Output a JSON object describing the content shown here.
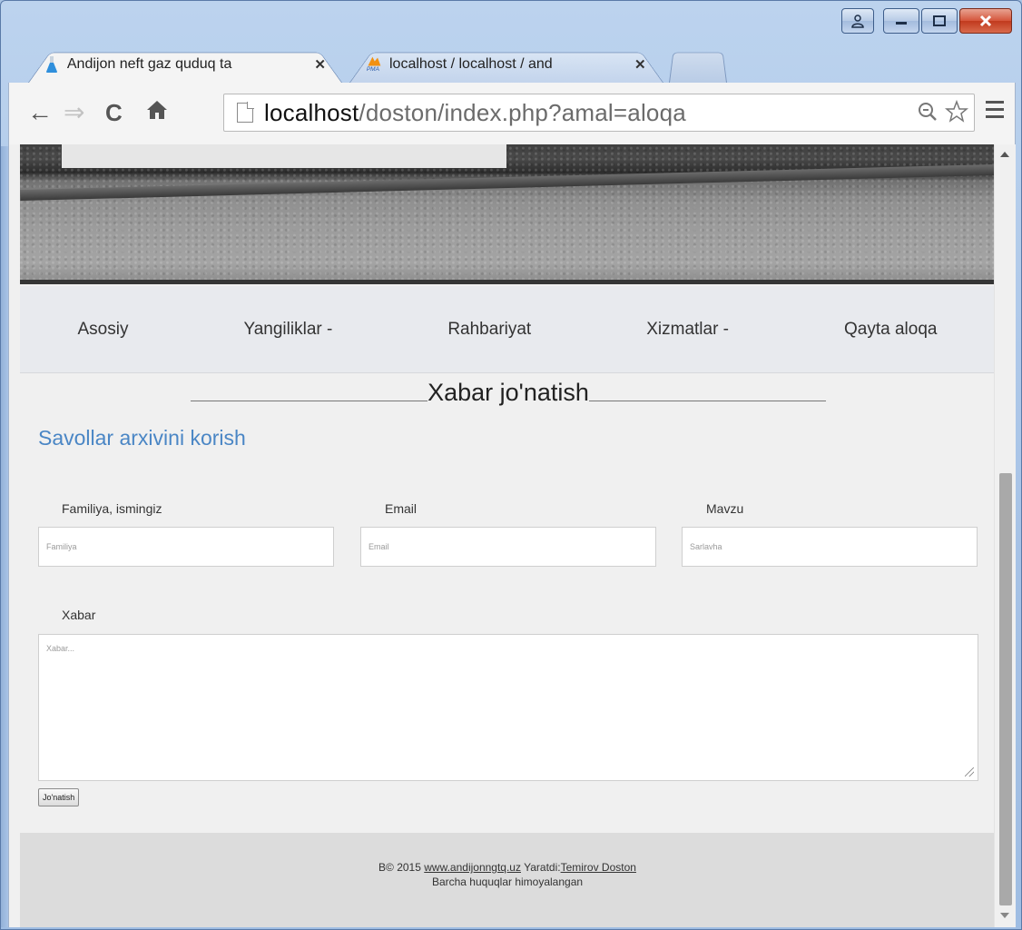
{
  "browser": {
    "tabs": [
      {
        "title": "Andijon neft gaz quduq ta",
        "icon": "flask-icon",
        "active": true
      },
      {
        "title": "localhost / localhost / and",
        "icon": "pma-icon",
        "active": false
      }
    ],
    "new_tab_icon": "new-tab-icon",
    "url_host": "localhost",
    "url_path": "/doston/index.php?amal=aloqa",
    "icons": [
      "back-icon",
      "forward-icon",
      "reload-icon",
      "home-icon",
      "zoom-icon",
      "star-icon",
      "menu-icon"
    ],
    "pma_icon_text": "PMA"
  },
  "nav": {
    "items": [
      "Asosiy",
      "Yangiliklar -",
      "Rahbariyat",
      "Xizmatlar -",
      "Qayta aloqa"
    ]
  },
  "page": {
    "heading": "Xabar jo'natish",
    "archive_link": "Savollar arxivini korish",
    "form": {
      "name_label": "Familiya, ismingiz",
      "name_placeholder": "Familiya",
      "email_label": "Email",
      "email_placeholder": "Email",
      "subject_label": "Mavzu",
      "subject_placeholder": "Sarlavha",
      "message_label": "Xabar",
      "message_placeholder": "Xabar...",
      "submit_label": "Jo'natish"
    }
  },
  "footer": {
    "copyright": "B© 2015",
    "site_link": "www.andijonngtq.uz",
    "created_by": "Yaratdi:",
    "author_link": "Temirov Doston",
    "rights": "Barcha huquqlar himoyalangan"
  },
  "colors": {
    "link": "#4a86c5",
    "window_frame": "#a6c2e6",
    "close_button": "#c13a1e"
  }
}
